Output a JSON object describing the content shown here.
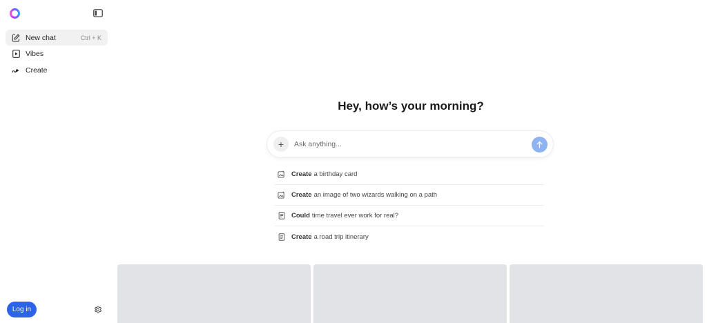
{
  "sidebar": {
    "logo": "copilot-logo",
    "toggle_icon": "sidebar-toggle-icon",
    "items": [
      {
        "label": "New chat",
        "shortcut": "Ctrl + K",
        "icon": "edit-icon"
      },
      {
        "label": "Vibes",
        "icon": "play-square-icon"
      },
      {
        "label": "Create",
        "icon": "brush-icon"
      }
    ],
    "login_label": "Log in",
    "settings_icon": "gear-icon"
  },
  "main": {
    "greeting": "Hey, how’s your morning?",
    "composer": {
      "placeholder": "Ask anything...",
      "value": ""
    },
    "suggestions": [
      {
        "verb": "Create",
        "rest": "a birthday card",
        "icon": "image-edit-icon"
      },
      {
        "verb": "Create",
        "rest": "an image of two wizards walking on a path",
        "icon": "image-edit-icon"
      },
      {
        "verb": "Could",
        "rest": "time travel ever work for real?",
        "icon": "document-icon"
      },
      {
        "verb": "Create",
        "rest": "a road trip itinerary",
        "icon": "document-icon"
      }
    ]
  },
  "colors": {
    "accent": "#2d63e6",
    "send_button": "#8fb2f2",
    "card_placeholder": "#e1e3e6"
  }
}
